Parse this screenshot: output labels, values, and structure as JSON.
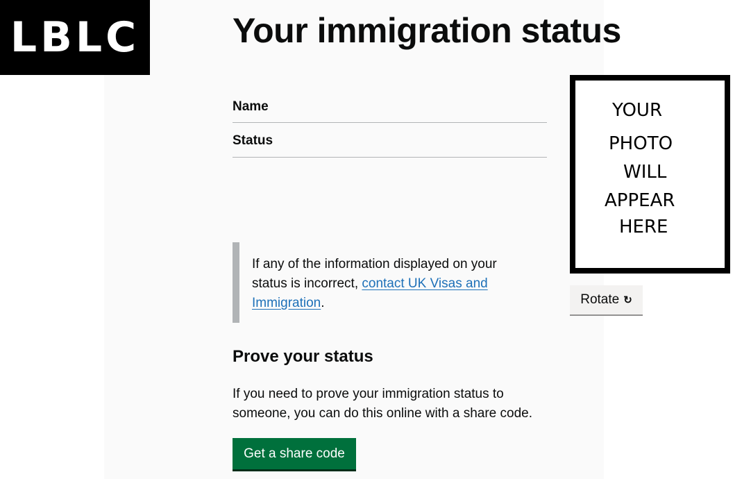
{
  "logo": {
    "text": "LBLC"
  },
  "page_title": "Your immigration status",
  "summary": {
    "rows": [
      {
        "key": "Name"
      },
      {
        "key": "Status"
      }
    ]
  },
  "inset": {
    "text_before": "If any of the information displayed on your status is incorrect, ",
    "link_text": "contact UK Visas and Immigration",
    "text_after": "."
  },
  "prove": {
    "heading": "Prove your status",
    "body": "If you need to prove your immigration status to someone, you can do this online with a share code.",
    "button_label": "Get a share code"
  },
  "photo": {
    "lines": [
      "YOUR",
      "PHOTO",
      "WILL",
      "APPEAR",
      "HERE"
    ]
  },
  "rotate": {
    "label": "Rotate",
    "icon": "rotate-icon"
  },
  "colors": {
    "primary_button": "#00703c",
    "link": "#1d70b8",
    "inset_border": "#b1b4b6"
  }
}
